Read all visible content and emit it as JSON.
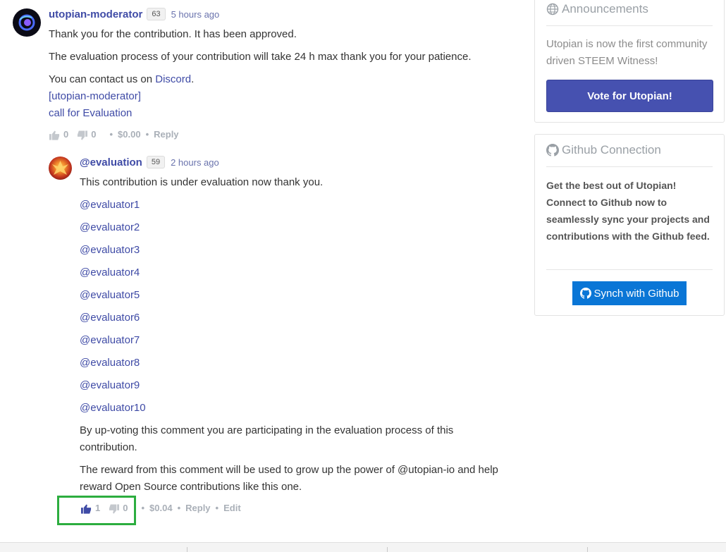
{
  "comment_moderator": {
    "author": "utopian-moderator",
    "reputation": "63",
    "time": "5 hours ago",
    "para1": "Thank you for the contribution. It has been approved.",
    "para2": "The evaluation process of your contribution will take 24 h max thank you for your patience.",
    "para3_prefix": "You can contact us on ",
    "para3_link": "Discord",
    "para3_suffix": ".",
    "signature_line1": "[utopian-moderator]",
    "signature_line2": "call for Evaluation",
    "actions": {
      "upvotes": "0",
      "downvotes": "0",
      "payout": "$0.00",
      "reply": "Reply"
    }
  },
  "comment_evaluation": {
    "author": "@evaluation",
    "reputation": "59",
    "time": "2 hours ago",
    "intro": "This contribution is under evaluation now thank you.",
    "evaluators": [
      "@evaluator1",
      "@evaluator2",
      "@evaluator3",
      "@evaluator4",
      "@evaluator5",
      "@evaluator6",
      "@evaluator7",
      "@evaluator8",
      "@evaluator9",
      "@evaluator10"
    ],
    "para_vote_1": "By up-voting this comment you are participating in the evaluation process of this",
    "para_vote_2": "contribution.",
    "para_reward_1": "The reward from this comment will be used to grow up the power of @utopian-io and help",
    "para_reward_2": "reward Open Source contributions like this one.",
    "actions": {
      "upvotes": "1",
      "downvotes": "0",
      "payout": "$0.04",
      "reply": "Reply",
      "edit": "Edit"
    }
  },
  "sidebar": {
    "announcements": {
      "title": "Announcements",
      "text": "Utopian is now the first community driven STEEM Witness!",
      "button": "Vote for Utopian!"
    },
    "github": {
      "title": "Github Connection",
      "text": "Get the best out of Utopian! Connect to Github now to seamlessly sync your projects and contributions with the Github feed.",
      "button": "Synch with Github"
    }
  },
  "colors": {
    "link": "#3f4ba6",
    "vote_button": "#4651b0",
    "sync_button": "#0a76d6",
    "highlight_box": "#2cad3f",
    "upvote_active": "#3f4ba6",
    "muted": "#aab0b8"
  }
}
